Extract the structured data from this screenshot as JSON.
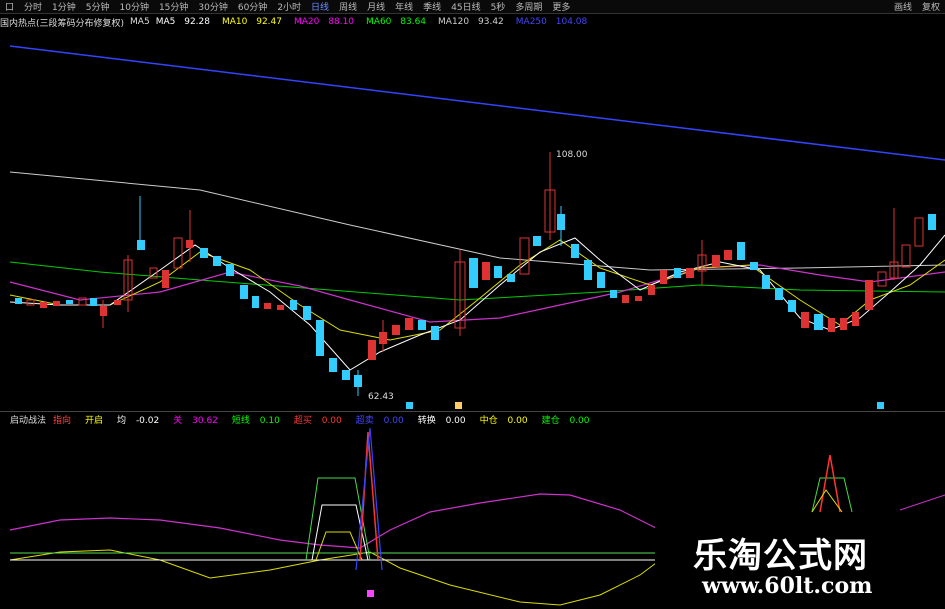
{
  "toolbar": {
    "tabs": [
      "口",
      "分时",
      "1分钟",
      "5分钟",
      "10分钟",
      "15分钟",
      "30分钟",
      "60分钟",
      "2小时",
      "日线",
      "周线",
      "月线",
      "年线",
      "季线",
      "45日线",
      "5秒",
      "多周期",
      "更多"
    ],
    "active_index": 9,
    "right": [
      "画线",
      "复权"
    ]
  },
  "main_legend": {
    "title": "国内热点(三段筹码分布修复权)",
    "ma_label": "MA5",
    "items": [
      {
        "label": "MA5",
        "value": "92.28",
        "color": "#ffffff"
      },
      {
        "label": "MA10",
        "value": "92.47",
        "color": "#ffff00"
      },
      {
        "label": "MA20",
        "value": "88.10",
        "color": "#ff00ff"
      },
      {
        "label": "MA60",
        "value": "83.64",
        "color": "#00ff00"
      },
      {
        "label": "MA120",
        "value": "93.42",
        "color": "#cccccc"
      },
      {
        "label": "MA250",
        "value": "104.08",
        "color": "#3333ff"
      }
    ]
  },
  "price_annotations": {
    "high": "108.00",
    "low": "62.43"
  },
  "sub_legend": {
    "title": "启动战法",
    "items": [
      {
        "label": "指向",
        "value": "",
        "color": "#ff4444"
      },
      {
        "label": "开启",
        "value": "",
        "color": "#ffff00"
      },
      {
        "label": "均",
        "value": "-0.02",
        "color": "#ffffff"
      },
      {
        "label": "关",
        "value": "30.62",
        "color": "#ff00ff"
      },
      {
        "label": "短线",
        "value": "0.10",
        "color": "#00ff00"
      },
      {
        "label": "超买",
        "value": "0.00",
        "color": "#ff0000"
      },
      {
        "label": "超卖",
        "value": "0.00",
        "color": "#0000ff"
      },
      {
        "label": "转换",
        "value": "0.00",
        "color": "#ffffff"
      },
      {
        "label": "中仓",
        "value": "0.00",
        "color": "#ffff00"
      },
      {
        "label": "建仓",
        "value": "0.00",
        "color": "#00ff00"
      }
    ]
  },
  "watermark": {
    "line1": "乐淘公式网",
    "line2": "www.60lt.com"
  }
}
